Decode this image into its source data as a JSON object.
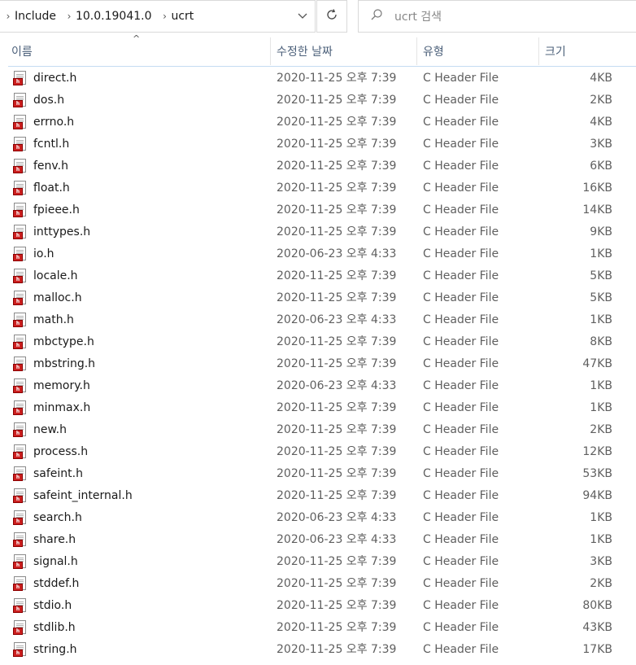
{
  "address_bar": {
    "crumbs": [
      "Include",
      "10.0.19041.0",
      "ucrt"
    ]
  },
  "search": {
    "placeholder": "ucrt 검색"
  },
  "columns": {
    "name": "이름",
    "date": "수정한 날짜",
    "type": "유형",
    "size": "크기"
  },
  "files": [
    {
      "name": "direct.h",
      "date": "2020-11-25 오후 7:39",
      "type": "C Header File",
      "size": "4KB"
    },
    {
      "name": "dos.h",
      "date": "2020-11-25 오후 7:39",
      "type": "C Header File",
      "size": "2KB"
    },
    {
      "name": "errno.h",
      "date": "2020-11-25 오후 7:39",
      "type": "C Header File",
      "size": "4KB"
    },
    {
      "name": "fcntl.h",
      "date": "2020-11-25 오후 7:39",
      "type": "C Header File",
      "size": "3KB"
    },
    {
      "name": "fenv.h",
      "date": "2020-11-25 오후 7:39",
      "type": "C Header File",
      "size": "6KB"
    },
    {
      "name": "float.h",
      "date": "2020-11-25 오후 7:39",
      "type": "C Header File",
      "size": "16KB"
    },
    {
      "name": "fpieee.h",
      "date": "2020-11-25 오후 7:39",
      "type": "C Header File",
      "size": "14KB"
    },
    {
      "name": "inttypes.h",
      "date": "2020-11-25 오후 7:39",
      "type": "C Header File",
      "size": "9KB"
    },
    {
      "name": "io.h",
      "date": "2020-06-23 오후 4:33",
      "type": "C Header File",
      "size": "1KB"
    },
    {
      "name": "locale.h",
      "date": "2020-11-25 오후 7:39",
      "type": "C Header File",
      "size": "5KB"
    },
    {
      "name": "malloc.h",
      "date": "2020-11-25 오후 7:39",
      "type": "C Header File",
      "size": "5KB"
    },
    {
      "name": "math.h",
      "date": "2020-06-23 오후 4:33",
      "type": "C Header File",
      "size": "1KB"
    },
    {
      "name": "mbctype.h",
      "date": "2020-11-25 오후 7:39",
      "type": "C Header File",
      "size": "8KB"
    },
    {
      "name": "mbstring.h",
      "date": "2020-11-25 오후 7:39",
      "type": "C Header File",
      "size": "47KB"
    },
    {
      "name": "memory.h",
      "date": "2020-06-23 오후 4:33",
      "type": "C Header File",
      "size": "1KB"
    },
    {
      "name": "minmax.h",
      "date": "2020-11-25 오후 7:39",
      "type": "C Header File",
      "size": "1KB"
    },
    {
      "name": "new.h",
      "date": "2020-11-25 오후 7:39",
      "type": "C Header File",
      "size": "2KB"
    },
    {
      "name": "process.h",
      "date": "2020-11-25 오후 7:39",
      "type": "C Header File",
      "size": "12KB"
    },
    {
      "name": "safeint.h",
      "date": "2020-11-25 오후 7:39",
      "type": "C Header File",
      "size": "53KB"
    },
    {
      "name": "safeint_internal.h",
      "date": "2020-11-25 오후 7:39",
      "type": "C Header File",
      "size": "94KB"
    },
    {
      "name": "search.h",
      "date": "2020-06-23 오후 4:33",
      "type": "C Header File",
      "size": "1KB"
    },
    {
      "name": "share.h",
      "date": "2020-06-23 오후 4:33",
      "type": "C Header File",
      "size": "1KB"
    },
    {
      "name": "signal.h",
      "date": "2020-11-25 오후 7:39",
      "type": "C Header File",
      "size": "3KB"
    },
    {
      "name": "stddef.h",
      "date": "2020-11-25 오후 7:39",
      "type": "C Header File",
      "size": "2KB"
    },
    {
      "name": "stdio.h",
      "date": "2020-11-25 오후 7:39",
      "type": "C Header File",
      "size": "80KB"
    },
    {
      "name": "stdlib.h",
      "date": "2020-11-25 오후 7:39",
      "type": "C Header File",
      "size": "43KB"
    },
    {
      "name": "string.h",
      "date": "2020-11-25 오후 7:39",
      "type": "C Header File",
      "size": "17KB"
    }
  ],
  "icons": {
    "breadcrumb_separator": "chevron-right-icon",
    "address_dropdown": "chevron-down-icon",
    "refresh": "refresh-icon",
    "search": "search-icon",
    "file": "c-header-file-icon",
    "sort_indicator": "sort-ascending-icon"
  },
  "colors": {
    "file_icon_tag": "#cc1f1f",
    "header_text": "#4c607a",
    "header_underline": "#c5dcf2"
  }
}
